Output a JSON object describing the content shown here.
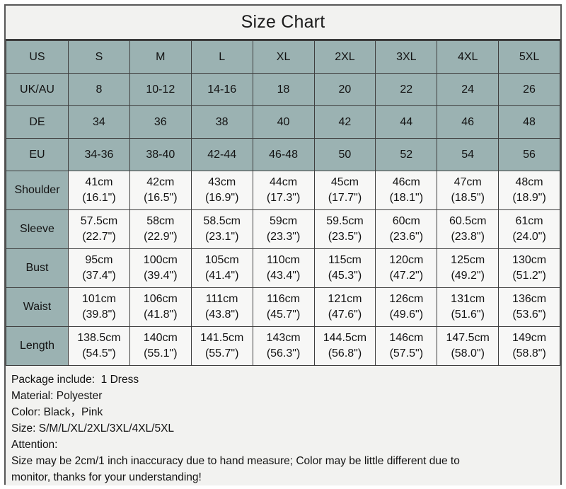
{
  "title": "Size Chart",
  "table": {
    "size_rows": [
      {
        "label": "US",
        "values": [
          "S",
          "M",
          "L",
          "XL",
          "2XL",
          "3XL",
          "4XL",
          "5XL"
        ]
      },
      {
        "label": "UK/AU",
        "values": [
          "8",
          "10-12",
          "14-16",
          "18",
          "20",
          "22",
          "24",
          "26"
        ]
      },
      {
        "label": "DE",
        "values": [
          "34",
          "36",
          "38",
          "40",
          "42",
          "44",
          "46",
          "48"
        ]
      },
      {
        "label": "EU",
        "values": [
          "34-36",
          "38-40",
          "42-44",
          "46-48",
          "50",
          "52",
          "54",
          "56"
        ]
      }
    ],
    "measure_rows": [
      {
        "label": "Shoulder",
        "cm": [
          "41cm",
          "42cm",
          "43cm",
          "44cm",
          "45cm",
          "46cm",
          "47cm",
          "48cm"
        ],
        "inch": [
          "(16.1\")",
          "(16.5\")",
          "(16.9\")",
          "(17.3\")",
          "(17.7\")",
          "(18.1\")",
          "(18.5\")",
          "(18.9\")"
        ]
      },
      {
        "label": "Sleeve",
        "cm": [
          "57.5cm",
          "58cm",
          "58.5cm",
          "59cm",
          "59.5cm",
          "60cm",
          "60.5cm",
          "61cm"
        ],
        "inch": [
          "(22.7\")",
          "(22.9\")",
          "(23.1\")",
          "(23.3\")",
          "(23.5\")",
          "(23.6\")",
          "(23.8\")",
          "(24.0\")"
        ]
      },
      {
        "label": "Bust",
        "cm": [
          "95cm",
          "100cm",
          "105cm",
          "110cm",
          "115cm",
          "120cm",
          "125cm",
          "130cm"
        ],
        "inch": [
          "(37.4\")",
          "(39.4\")",
          "(41.4\")",
          "(43.4\")",
          "(45.3\")",
          "(47.2\")",
          "(49.2\")",
          "(51.2\")"
        ]
      },
      {
        "label": "Waist",
        "cm": [
          "101cm",
          "106cm",
          "111cm",
          "116cm",
          "121cm",
          "126cm",
          "131cm",
          "136cm"
        ],
        "inch": [
          "(39.8\")",
          "(41.8\")",
          "(43.8\")",
          "(45.7\")",
          "(47.6\")",
          "(49.6\")",
          "(51.6\")",
          "(53.6\")"
        ]
      },
      {
        "label": "Length",
        "cm": [
          "138.5cm",
          "140cm",
          "141.5cm",
          "143cm",
          "144.5cm",
          "146cm",
          "147.5cm",
          "149cm"
        ],
        "inch": [
          "(54.5\")",
          "(55.1\")",
          "(55.7\")",
          "(56.3\")",
          "(56.8\")",
          "(57.5\")",
          "(58.0\")",
          "(58.8\")"
        ]
      }
    ]
  },
  "notes": {
    "package": "Package include:  1 Dress",
    "material": "Material: Polyester",
    "color": "Color: Black，Pink",
    "size": "Size: S/M/L/XL/2XL/3XL/4XL/5XL",
    "attention_label": "Attention:",
    "attention_line1": "Size may be 2cm/1 inch inaccuracy due to hand measure; Color may be little different due to",
    "attention_line2": "monitor, thanks for your understanding!"
  },
  "colors": {
    "header_teal": "#9bb2b2",
    "cell_bg": "#f7f7f6",
    "panel_bg": "#f2f2f0",
    "border": "#3f3f3f",
    "outer_border": "#575757",
    "text": "#131313"
  }
}
